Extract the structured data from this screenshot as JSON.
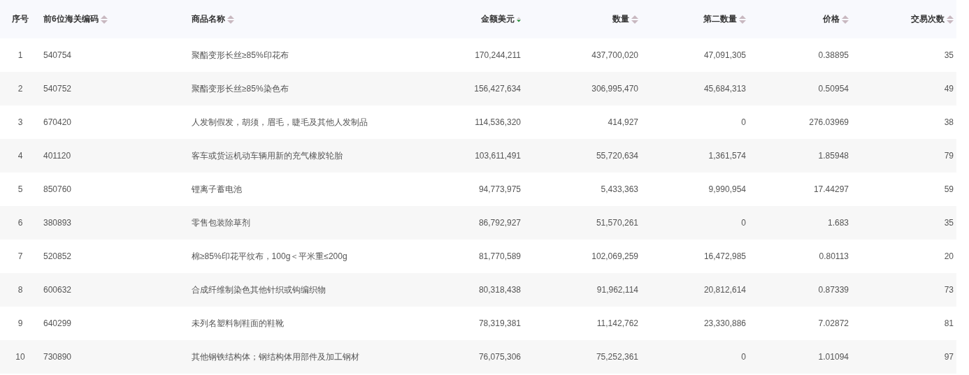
{
  "table": {
    "columns": [
      {
        "label": "序号",
        "sortable": false,
        "sorted_descending": false
      },
      {
        "label": "前6位海关编码",
        "sortable": true,
        "sorted_descending": false
      },
      {
        "label": "商品名称",
        "sortable": true,
        "sorted_descending": false
      },
      {
        "label": "金额美元",
        "sortable": true,
        "sorted_descending": true
      },
      {
        "label": "数量",
        "sortable": true,
        "sorted_descending": false
      },
      {
        "label": "第二数量",
        "sortable": true,
        "sorted_descending": false
      },
      {
        "label": "价格",
        "sortable": true,
        "sorted_descending": false
      },
      {
        "label": "交易次数",
        "sortable": true,
        "sorted_descending": false
      }
    ],
    "rows": [
      [
        "1",
        "540754",
        "聚酯变形长丝≥85%印花布",
        "170,244,211",
        "437,700,020",
        "47,091,305",
        "0.38895",
        "35"
      ],
      [
        "2",
        "540752",
        "聚酯变形长丝≥85%染色布",
        "156,427,634",
        "306,995,470",
        "45,684,313",
        "0.50954",
        "49"
      ],
      [
        "3",
        "670420",
        "人发制假发，胡须，眉毛，睫毛及其他人发制品",
        "114,536,320",
        "414,927",
        "0",
        "276.03969",
        "38"
      ],
      [
        "4",
        "401120",
        "客车或货运机动车辆用新的充气橡胶轮胎",
        "103,611,491",
        "55,720,634",
        "1,361,574",
        "1.85948",
        "79"
      ],
      [
        "5",
        "850760",
        "锂离子蓄电池",
        "94,773,975",
        "5,433,363",
        "9,990,954",
        "17.44297",
        "59"
      ],
      [
        "6",
        "380893",
        "零售包装除草剂",
        "86,792,927",
        "51,570,261",
        "0",
        "1.683",
        "35"
      ],
      [
        "7",
        "520852",
        "棉≥85%印花平纹布，100g＜平米重≤200g",
        "81,770,589",
        "102,069,259",
        "16,472,985",
        "0.80113",
        "20"
      ],
      [
        "8",
        "600632",
        "合成纤维制染色其他针织或钩编织物",
        "80,318,438",
        "91,962,114",
        "20,812,614",
        "0.87339",
        "73"
      ],
      [
        "9",
        "640299",
        "未列名塑料制鞋面的鞋靴",
        "78,319,381",
        "11,142,762",
        "23,330,886",
        "7.02872",
        "81"
      ],
      [
        "10",
        "730890",
        "其他钢铁结构体；钢结构体用部件及加工钢材",
        "76,075,306",
        "75,252,361",
        "0",
        "1.01094",
        "97"
      ]
    ]
  }
}
